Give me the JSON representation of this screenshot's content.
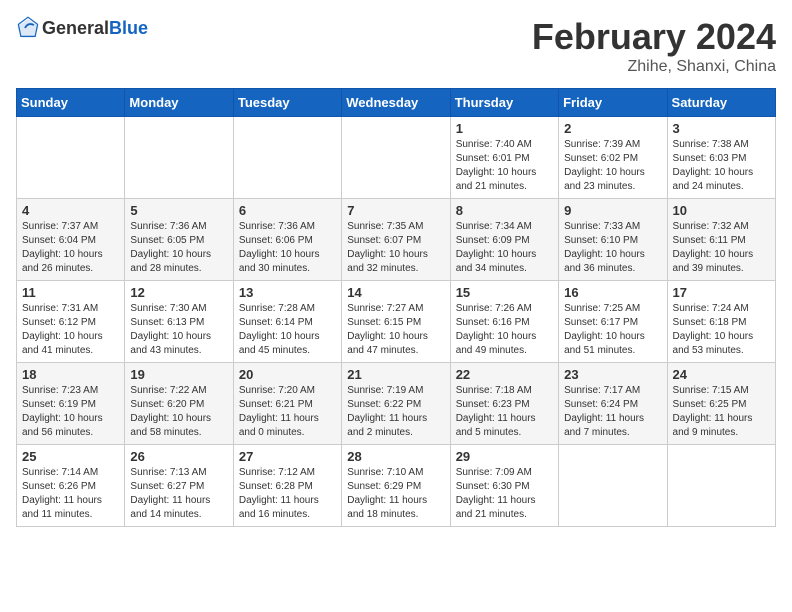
{
  "header": {
    "logo": {
      "general": "General",
      "blue": "Blue"
    },
    "title": "February 2024",
    "location": "Zhihe, Shanxi, China"
  },
  "days_of_week": [
    "Sunday",
    "Monday",
    "Tuesday",
    "Wednesday",
    "Thursday",
    "Friday",
    "Saturday"
  ],
  "weeks": [
    [
      {
        "day": "",
        "info": ""
      },
      {
        "day": "",
        "info": ""
      },
      {
        "day": "",
        "info": ""
      },
      {
        "day": "",
        "info": ""
      },
      {
        "day": "1",
        "info": "Sunrise: 7:40 AM\nSunset: 6:01 PM\nDaylight: 10 hours and 21 minutes."
      },
      {
        "day": "2",
        "info": "Sunrise: 7:39 AM\nSunset: 6:02 PM\nDaylight: 10 hours and 23 minutes."
      },
      {
        "day": "3",
        "info": "Sunrise: 7:38 AM\nSunset: 6:03 PM\nDaylight: 10 hours and 24 minutes."
      }
    ],
    [
      {
        "day": "4",
        "info": "Sunrise: 7:37 AM\nSunset: 6:04 PM\nDaylight: 10 hours and 26 minutes."
      },
      {
        "day": "5",
        "info": "Sunrise: 7:36 AM\nSunset: 6:05 PM\nDaylight: 10 hours and 28 minutes."
      },
      {
        "day": "6",
        "info": "Sunrise: 7:36 AM\nSunset: 6:06 PM\nDaylight: 10 hours and 30 minutes."
      },
      {
        "day": "7",
        "info": "Sunrise: 7:35 AM\nSunset: 6:07 PM\nDaylight: 10 hours and 32 minutes."
      },
      {
        "day": "8",
        "info": "Sunrise: 7:34 AM\nSunset: 6:09 PM\nDaylight: 10 hours and 34 minutes."
      },
      {
        "day": "9",
        "info": "Sunrise: 7:33 AM\nSunset: 6:10 PM\nDaylight: 10 hours and 36 minutes."
      },
      {
        "day": "10",
        "info": "Sunrise: 7:32 AM\nSunset: 6:11 PM\nDaylight: 10 hours and 39 minutes."
      }
    ],
    [
      {
        "day": "11",
        "info": "Sunrise: 7:31 AM\nSunset: 6:12 PM\nDaylight: 10 hours and 41 minutes."
      },
      {
        "day": "12",
        "info": "Sunrise: 7:30 AM\nSunset: 6:13 PM\nDaylight: 10 hours and 43 minutes."
      },
      {
        "day": "13",
        "info": "Sunrise: 7:28 AM\nSunset: 6:14 PM\nDaylight: 10 hours and 45 minutes."
      },
      {
        "day": "14",
        "info": "Sunrise: 7:27 AM\nSunset: 6:15 PM\nDaylight: 10 hours and 47 minutes."
      },
      {
        "day": "15",
        "info": "Sunrise: 7:26 AM\nSunset: 6:16 PM\nDaylight: 10 hours and 49 minutes."
      },
      {
        "day": "16",
        "info": "Sunrise: 7:25 AM\nSunset: 6:17 PM\nDaylight: 10 hours and 51 minutes."
      },
      {
        "day": "17",
        "info": "Sunrise: 7:24 AM\nSunset: 6:18 PM\nDaylight: 10 hours and 53 minutes."
      }
    ],
    [
      {
        "day": "18",
        "info": "Sunrise: 7:23 AM\nSunset: 6:19 PM\nDaylight: 10 hours and 56 minutes."
      },
      {
        "day": "19",
        "info": "Sunrise: 7:22 AM\nSunset: 6:20 PM\nDaylight: 10 hours and 58 minutes."
      },
      {
        "day": "20",
        "info": "Sunrise: 7:20 AM\nSunset: 6:21 PM\nDaylight: 11 hours and 0 minutes."
      },
      {
        "day": "21",
        "info": "Sunrise: 7:19 AM\nSunset: 6:22 PM\nDaylight: 11 hours and 2 minutes."
      },
      {
        "day": "22",
        "info": "Sunrise: 7:18 AM\nSunset: 6:23 PM\nDaylight: 11 hours and 5 minutes."
      },
      {
        "day": "23",
        "info": "Sunrise: 7:17 AM\nSunset: 6:24 PM\nDaylight: 11 hours and 7 minutes."
      },
      {
        "day": "24",
        "info": "Sunrise: 7:15 AM\nSunset: 6:25 PM\nDaylight: 11 hours and 9 minutes."
      }
    ],
    [
      {
        "day": "25",
        "info": "Sunrise: 7:14 AM\nSunset: 6:26 PM\nDaylight: 11 hours and 11 minutes."
      },
      {
        "day": "26",
        "info": "Sunrise: 7:13 AM\nSunset: 6:27 PM\nDaylight: 11 hours and 14 minutes."
      },
      {
        "day": "27",
        "info": "Sunrise: 7:12 AM\nSunset: 6:28 PM\nDaylight: 11 hours and 16 minutes."
      },
      {
        "day": "28",
        "info": "Sunrise: 7:10 AM\nSunset: 6:29 PM\nDaylight: 11 hours and 18 minutes."
      },
      {
        "day": "29",
        "info": "Sunrise: 7:09 AM\nSunset: 6:30 PM\nDaylight: 11 hours and 21 minutes."
      },
      {
        "day": "",
        "info": ""
      },
      {
        "day": "",
        "info": ""
      }
    ]
  ]
}
